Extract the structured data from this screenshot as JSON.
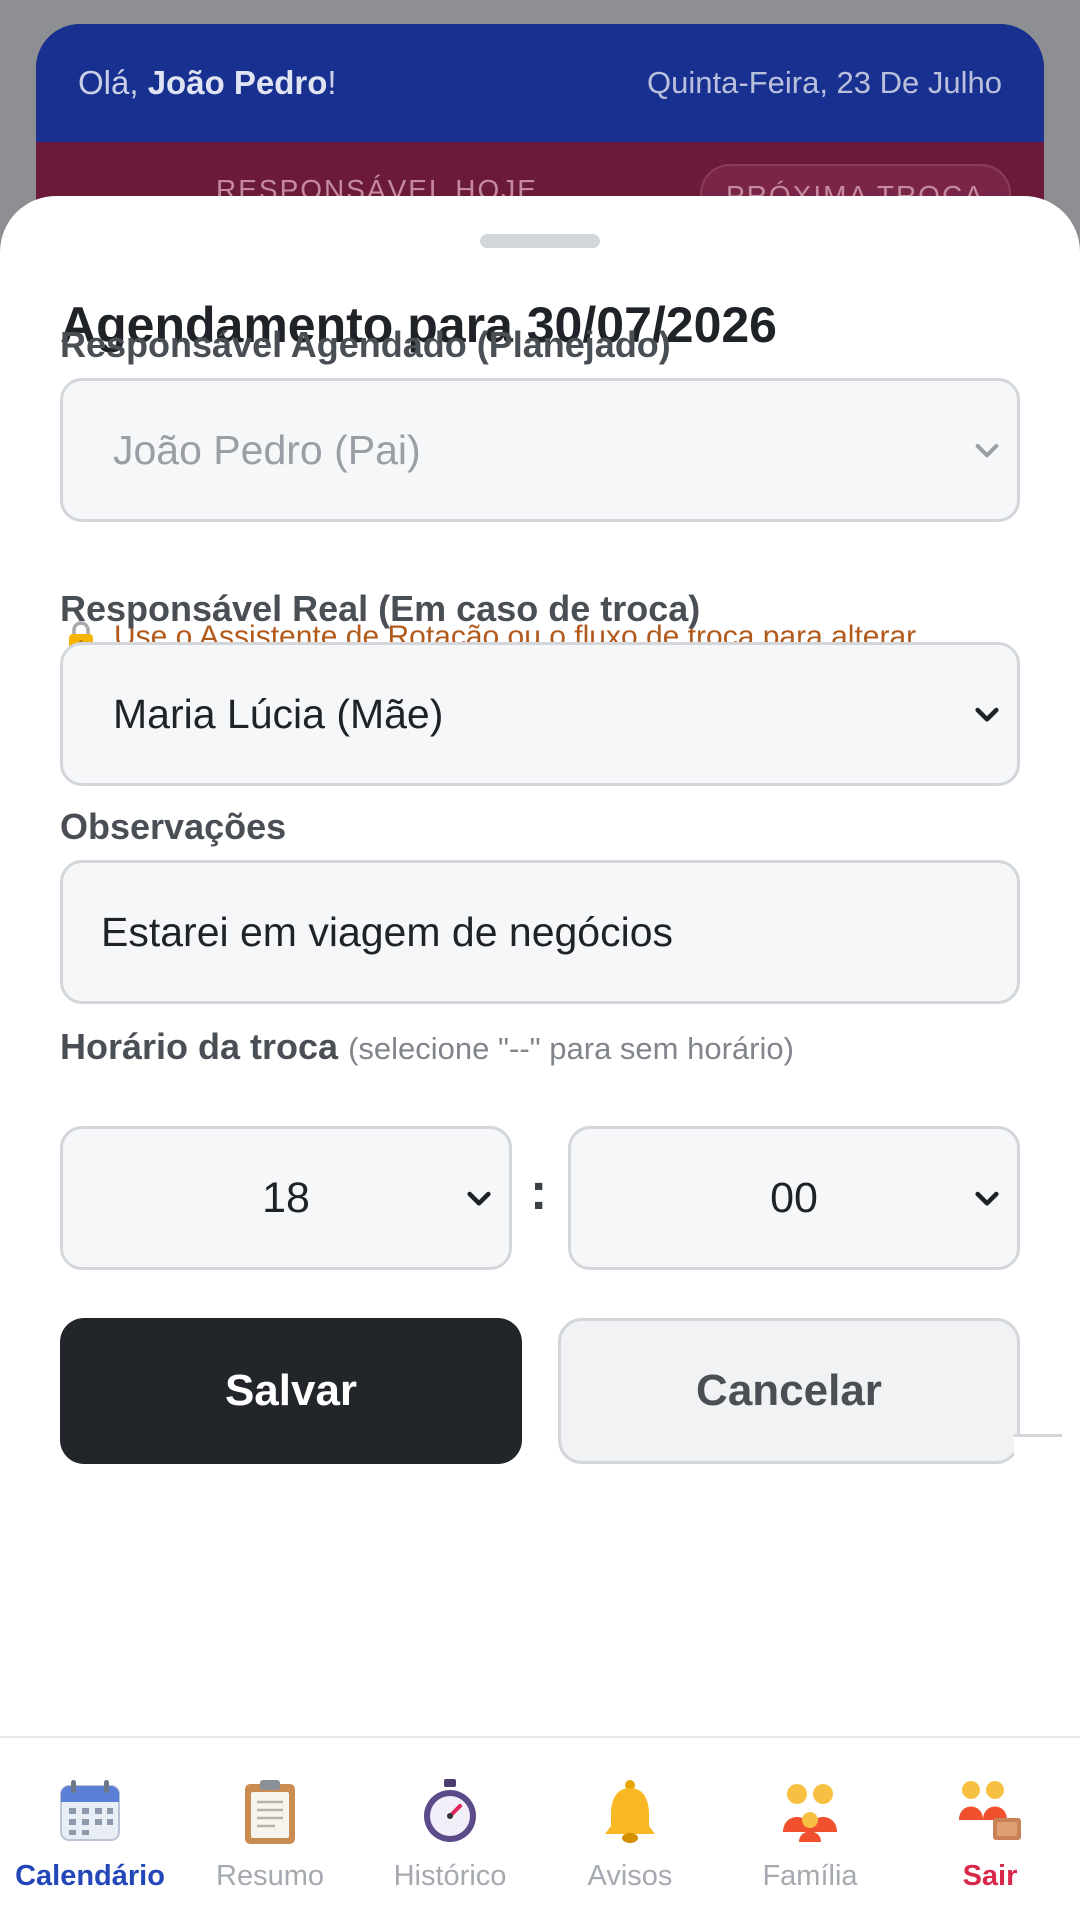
{
  "header": {
    "greeting_prefix": "Olá, ",
    "user_name": "João Pedro",
    "greeting_suffix": "!",
    "date": "Quinta-Feira, 23 De Julho",
    "responsible_label": "RESPONSÁVEL HOJE",
    "next_swap_label": "PRÓXIMA TROCA"
  },
  "sheet": {
    "title": "Agendamento para 30/07/2026",
    "planned_label": "Responsável Agendado (Planejado)",
    "planned_value": "João Pedro (Pai)",
    "planned_notice": "Use o Assistente de Rotação ou o fluxo de troca para alterar",
    "actual_label": "Responsável Real (Em caso de troca)",
    "actual_value": "Maria Lúcia (Mãe)",
    "notes_label": "Observações",
    "notes_value": "Estarei em viagem de negócios",
    "time_label": "Horário da troca",
    "time_hint": "(selecione \"--\" para sem horário)",
    "hour_value": "18",
    "separator": ":",
    "minute_value": "00",
    "save_label": "Salvar",
    "cancel_label": "Cancelar"
  },
  "nav": {
    "items": [
      {
        "label": "Calendário",
        "icon": "calendar-icon"
      },
      {
        "label": "Resumo",
        "icon": "clipboard-icon"
      },
      {
        "label": "Histórico",
        "icon": "stopwatch-icon"
      },
      {
        "label": "Avisos",
        "icon": "bell-icon"
      },
      {
        "label": "Família",
        "icon": "family-icon"
      },
      {
        "label": "Sair",
        "icon": "logout-icon"
      }
    ]
  },
  "colors": {
    "header_blue": "#18308f",
    "strip_wine": "#6b1a39",
    "active_nav": "#2347b8",
    "logout_red": "#d8284a",
    "notice_orange": "#b25a1c",
    "save_button": "#22262b"
  }
}
